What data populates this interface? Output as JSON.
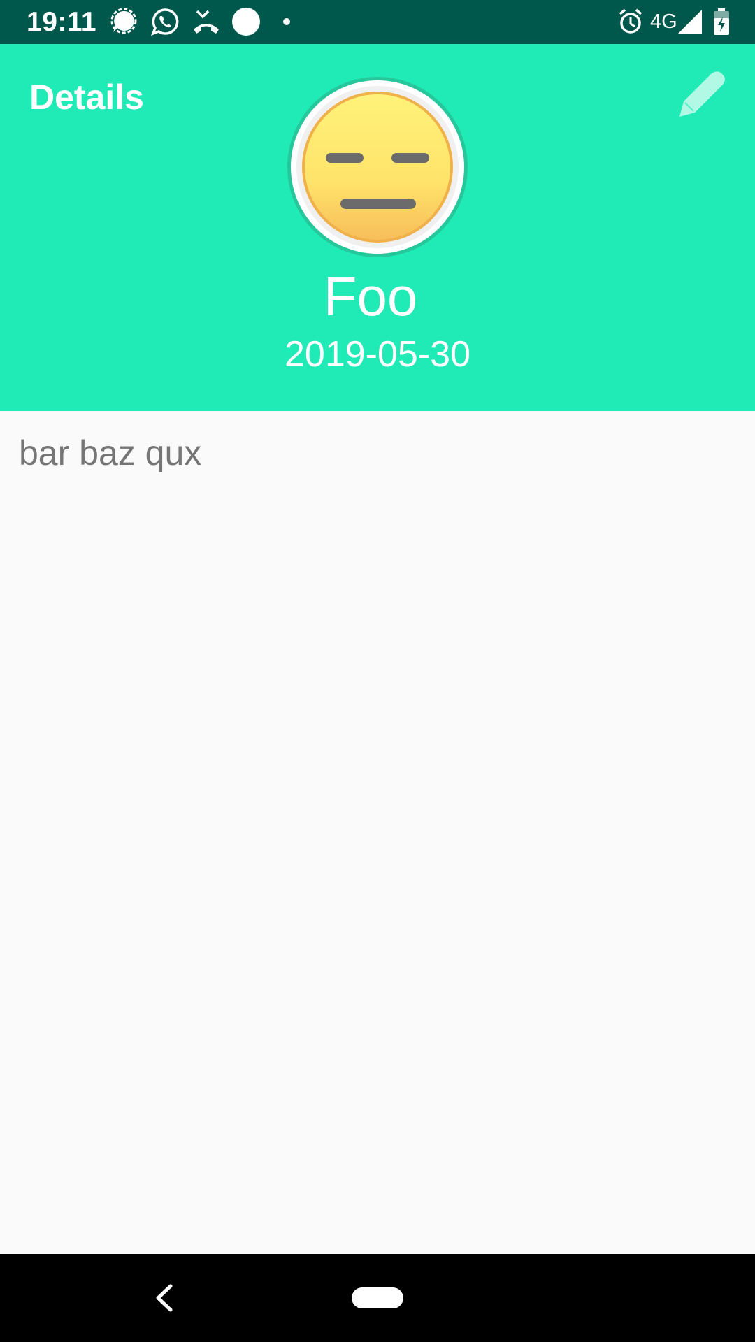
{
  "status_bar": {
    "time": "19:11",
    "network": "4G",
    "notification_icons": [
      "signal-app-icon",
      "whatsapp-icon",
      "missed-call-icon",
      "circle-notification-icon",
      "more-dot-icon"
    ],
    "system_icons": [
      "alarm-icon",
      "cell-signal-icon",
      "battery-charging-icon"
    ],
    "background_color": "#00584c"
  },
  "header": {
    "title": "Details",
    "edit_icon": "pencil-icon",
    "avatar_icon": "expressionless-face-emoji",
    "name": "Foo",
    "date": "2019-05-30",
    "background_color": "#20eab6"
  },
  "content": {
    "description": "bar baz qux"
  },
  "nav_bar": {
    "back_icon": "back-chevron-icon",
    "home_icon": "home-pill-icon"
  }
}
